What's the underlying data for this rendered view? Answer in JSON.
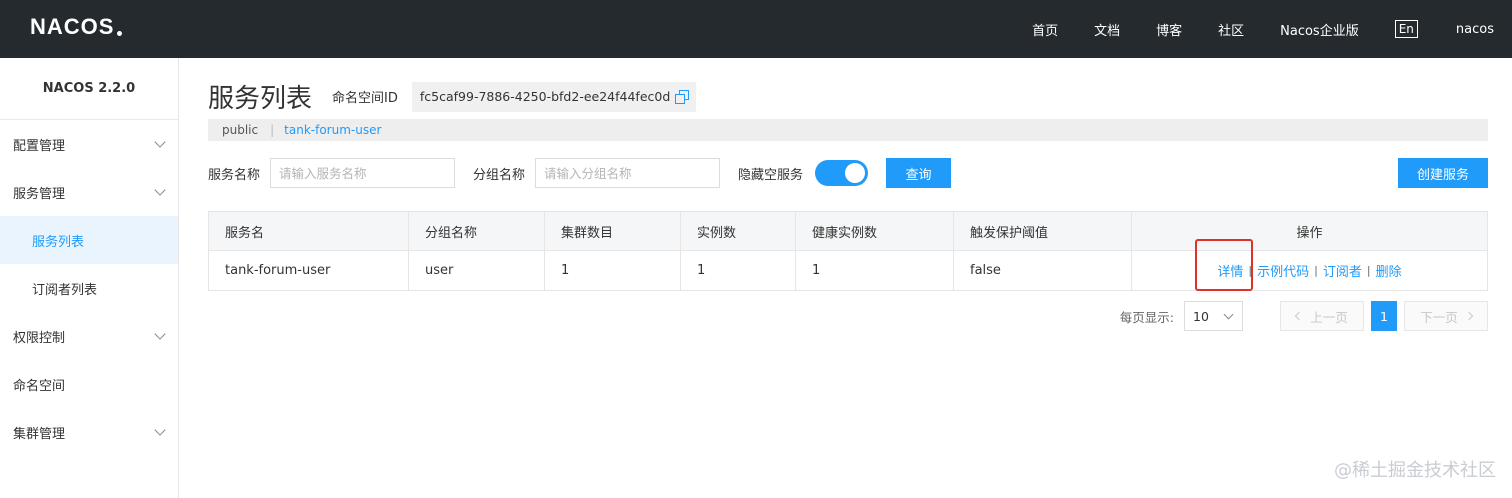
{
  "header": {
    "logo": "NACOS",
    "nav": [
      "首页",
      "文档",
      "博客",
      "社区",
      "Nacos企业版"
    ],
    "lang": "En",
    "user": "nacos"
  },
  "sidebar": {
    "version": "NACOS 2.2.0",
    "items": [
      {
        "label": "配置管理"
      },
      {
        "label": "服务管理"
      },
      {
        "label": "服务列表"
      },
      {
        "label": "订阅者列表"
      },
      {
        "label": "权限控制"
      },
      {
        "label": "命名空间"
      },
      {
        "label": "集群管理"
      }
    ]
  },
  "main": {
    "title": "服务列表",
    "namespace_label": "命名空间ID",
    "namespace_id": "fc5caf99-7886-4250-bfd2-ee24f44fec0d",
    "ns_bar": {
      "public": "public",
      "separator": "|",
      "current": "tank-forum-user"
    },
    "filters": {
      "service_label": "服务名称",
      "service_placeholder": "请输入服务名称",
      "group_label": "分组名称",
      "group_placeholder": "请输入分组名称",
      "hide_empty_label": "隐藏空服务",
      "query_button": "查询",
      "create_button": "创建服务"
    },
    "table": {
      "columns": [
        "服务名",
        "分组名称",
        "集群数目",
        "实例数",
        "健康实例数",
        "触发保护阈值",
        "操作"
      ],
      "rows": [
        {
          "name": "tank-forum-user",
          "group": "user",
          "clusters": "1",
          "instances": "1",
          "healthy": "1",
          "threshold": "false",
          "ops": [
            "详情",
            "示例代码",
            "订阅者",
            "删除"
          ],
          "sep": "|"
        }
      ]
    },
    "pagination": {
      "per_page_label": "每页显示:",
      "per_page": "10",
      "prev": "上一页",
      "next": "下一页",
      "current": "1"
    }
  },
  "watermark": "@稀土掘金技术社区"
}
